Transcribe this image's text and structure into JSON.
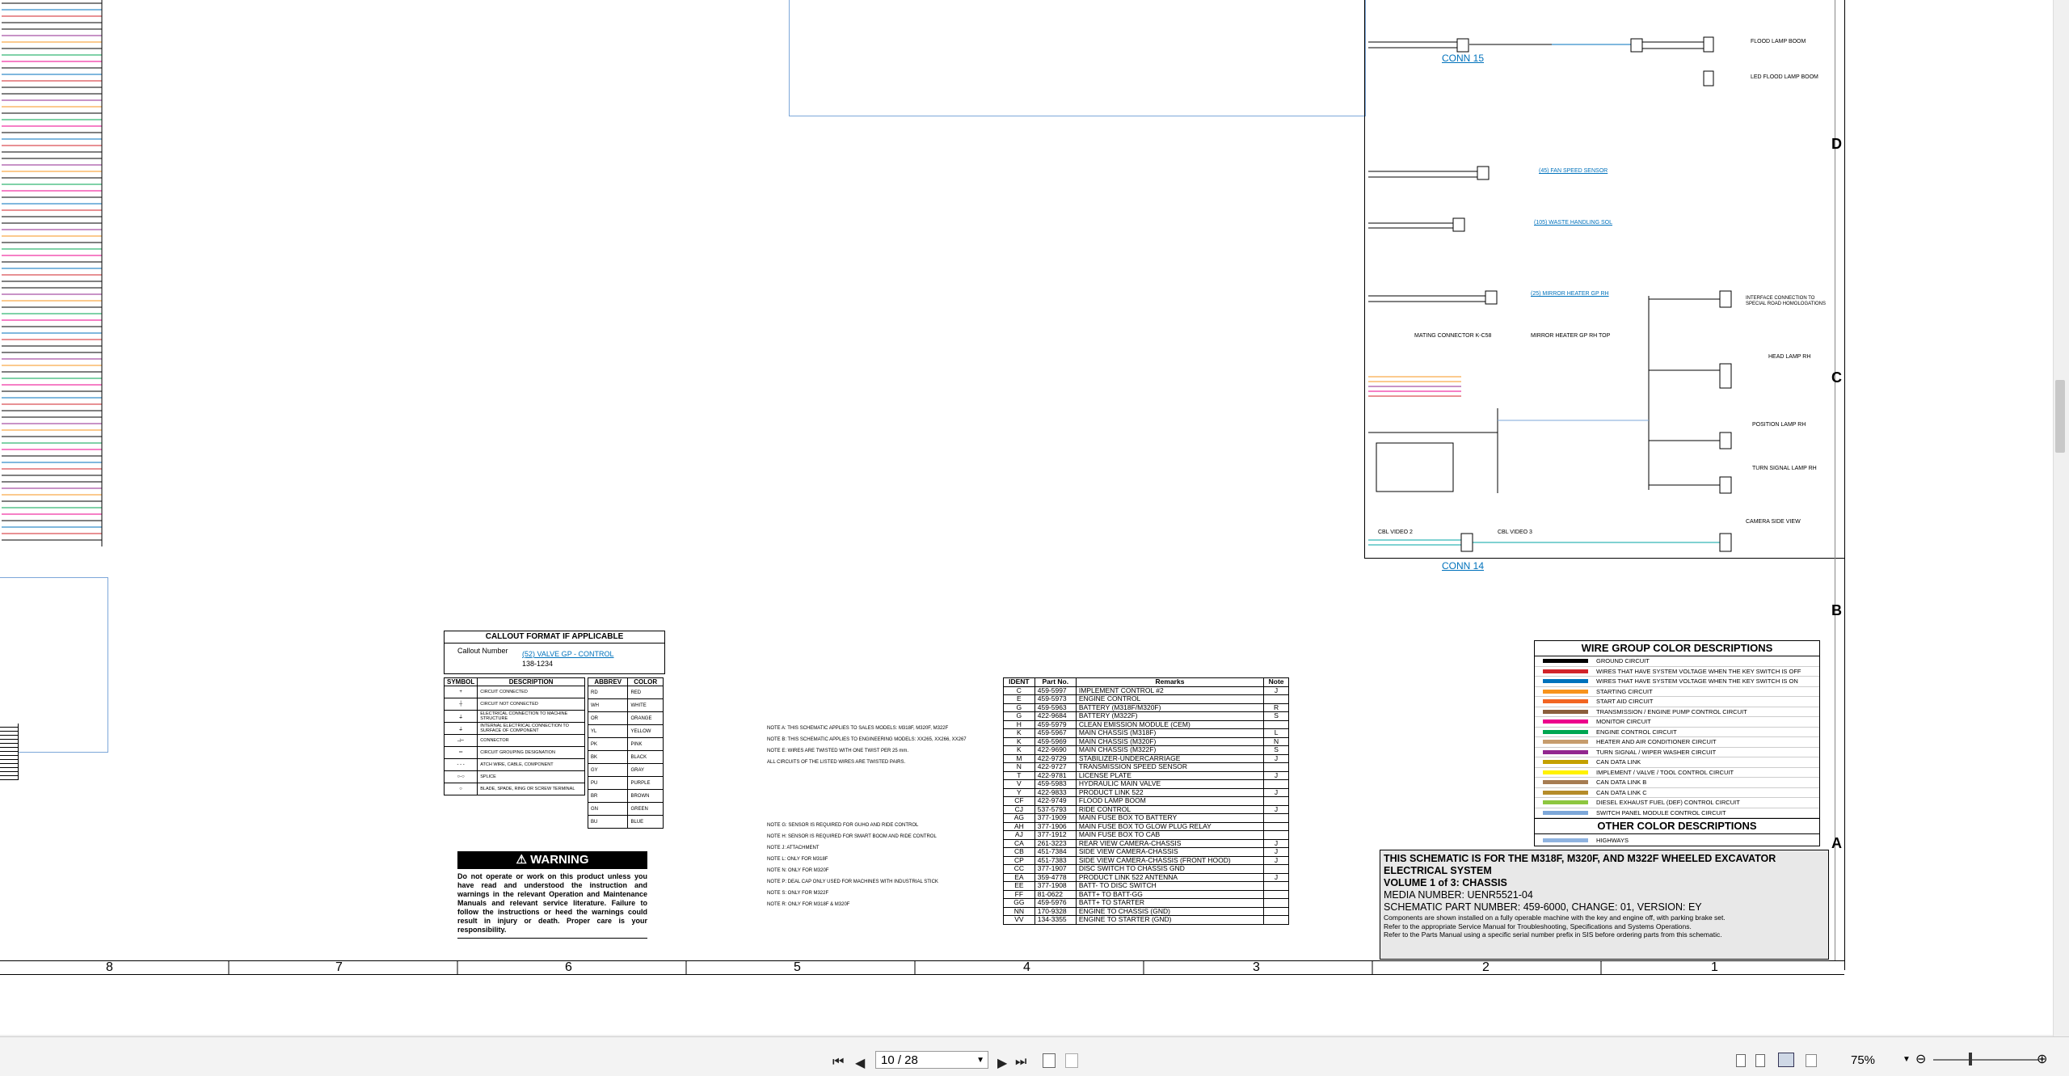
{
  "toolbar": {
    "page_value": "10 / 28",
    "zoom": "75%",
    "first_page_icon": "first-page-icon",
    "prev_page_icon": "prev-page-icon",
    "next_page_icon": "next-page-icon",
    "last_page_icon": "last-page-icon"
  },
  "schematic": {
    "row_labels": [
      "D",
      "C",
      "B",
      "A"
    ],
    "col_labels": [
      "8",
      "7",
      "6",
      "5",
      "4",
      "3",
      "2",
      "1"
    ],
    "connectors": {
      "conn15": "CONN 15",
      "conn14": "CONN 14",
      "flood_lamp": "FLOOD LAMP BOOM",
      "led_flood": "LED FLOOD LAMP BOOM",
      "fan_speed": "(45) FAN SPEED SENSOR",
      "waste_sol": "(105) WASTE HANDLING SOL",
      "mirror_heater_rh": "(25) MIRROR HEATER GP RH",
      "mirror_heater_top": "MIRROR HEATER GP RH TOP",
      "head_lamp": "HEAD LAMP RH",
      "position_lamp": "POSITION LAMP RH",
      "turn_signal": "TURN SIGNAL LAMP RH",
      "camera": "CAMERA SIDE VIEW",
      "cbl_video2": "CBL VIDEO 2",
      "cbl_video3": "CBL VIDEO 3",
      "interface": "INTERFACE CONNECTION TO SPECIAL ROAD HOMOLOGATIONS",
      "mating": "MATING CONNECTOR K-C58"
    }
  },
  "callout": {
    "title": "CALLOUT FORMAT IF APPLICABLE",
    "callout_number": "Callout Number",
    "valve_label": "(52) VALVE GP - CONTROL",
    "part_number": "138-1234",
    "headers": [
      "SYMBOL",
      "DESCRIPTION",
      "ABBREV",
      "COLOR"
    ],
    "descriptions": [
      "CIRCUIT CONNECTED",
      "CIRCUIT NOT CONNECTED",
      "ELECTRICAL CONNECTION TO MACHINE STRUCTURE",
      "INTERNAL ELECTRICAL CONNECTION TO SURFACE OF COMPONENT",
      "CONNECTOR",
      "CIRCUIT GROUPING DESIGNATION",
      "ATCH WIRE, CABLE, COMPONENT",
      "SPLICE",
      "BLADE, SPADE, RING OR SCREW TERMINAL"
    ],
    "abbrevs": [
      "RD",
      "WH",
      "OR",
      "YL",
      "PK",
      "BK",
      "GY",
      "PU",
      "BR",
      "GN",
      "BU"
    ],
    "colors": [
      "RED",
      "WHITE",
      "ORANGE",
      "YELLOW",
      "PINK",
      "BLACK",
      "GRAY",
      "PURPLE",
      "BROWN",
      "GREEN",
      "BLUE"
    ]
  },
  "warning": {
    "title": "WARNING",
    "text": "Do not operate or work on this product unless you have read and understood the instruction and warnings in the relevant Operation and Maintenance Manuals and relevant service literature. Failure to follow the instructions or heed the warnings could result in injury or death. Proper care is your responsibility."
  },
  "notes": [
    "NOTE A: THIS SCHEMATIC APPLIES TO SALES MODELS: M318F, M320F, M322F",
    "NOTE B: THIS SCHEMATIC APPLIES TO ENGINEERING MODELS: XX265, XX266, XX267",
    "NOTE E: WIRES ARE TWISTED WITH ONE TWIST PER 25 mm.",
    "ALL CIRCUITS OF THE LISTED WIRES ARE TWISTED PAIRS.",
    "NOTE G: SENSOR IS REQUIRED FOR GUHO AND RIDE CONTROL",
    "NOTE H: SENSOR IS REQUIRED FOR SMART BOOM AND RIDE CONTROL",
    "NOTE J: ATTACHMENT",
    "NOTE L: ONLY FOR M318F",
    "NOTE N: ONLY FOR M320F",
    "NOTE P: DEAL CAP ONLY USED FOR MACHINES WITH INDUSTRIAL STICK",
    "NOTE S: ONLY FOR M322F",
    "NOTE R: ONLY FOR M318F & M320F"
  ],
  "parts_table": {
    "headers": [
      "IDENT",
      "Part No.",
      "Remarks",
      "Note"
    ],
    "rows": [
      [
        "C",
        "459-5997",
        "IMPLEMENT CONTROL #2",
        "J"
      ],
      [
        "E",
        "459-5973",
        "ENGINE CONTROL",
        ""
      ],
      [
        "G",
        "459-5963",
        "BATTERY (M318F/M320F)",
        "R"
      ],
      [
        "G",
        "422-9684",
        "BATTERY (M322F)",
        "S"
      ],
      [
        "H",
        "459-5979",
        "CLEAN EMISSION MODULE (CEM)",
        ""
      ],
      [
        "K",
        "459-5967",
        "MAIN CHASSIS (M318F)",
        "L"
      ],
      [
        "K",
        "459-5969",
        "MAIN CHASSIS (M320F)",
        "N"
      ],
      [
        "K",
        "422-9690",
        "MAIN CHASSIS (M322F)",
        "S"
      ],
      [
        "M",
        "422-9729",
        "STABILIZER-UNDERCARRIAGE",
        "J"
      ],
      [
        "N",
        "422-9727",
        "TRANSMISSION SPEED SENSOR",
        ""
      ],
      [
        "T",
        "422-9781",
        "LICENSE PLATE",
        "J"
      ],
      [
        "V",
        "459-5983",
        "HYDRAULIC MAIN VALVE",
        ""
      ],
      [
        "Y",
        "422-9833",
        "PRODUCT LINK 522",
        "J"
      ],
      [
        "CF",
        "422-9749",
        "FLOOD LAMP BOOM",
        ""
      ],
      [
        "CJ",
        "537-5793",
        "RIDE CONTROL",
        "J"
      ],
      [
        "AG",
        "377-1909",
        "MAIN FUSE BOX TO BATTERY",
        ""
      ],
      [
        "AH",
        "377-1906",
        "MAIN FUSE BOX TO GLOW PLUG RELAY",
        ""
      ],
      [
        "AJ",
        "377-1912",
        "MAIN FUSE BOX TO CAB",
        ""
      ],
      [
        "CA",
        "261-3223",
        "REAR VIEW CAMERA-CHASSIS",
        "J"
      ],
      [
        "CB",
        "451-7384",
        "SIDE VIEW CAMERA-CHASSIS",
        "J"
      ],
      [
        "CP",
        "451-7383",
        "SIDE VIEW CAMERA-CHASSIS (FRONT HOOD)",
        "J"
      ],
      [
        "CC",
        "377-1907",
        "DISC SWITCH TO CHASSIS GND",
        ""
      ],
      [
        "EA",
        "359-4778",
        "PRODUCT LINK 522 ANTENNA",
        "J"
      ],
      [
        "EE",
        "377-1908",
        "BATT- TO DISC SWITCH",
        ""
      ],
      [
        "FF",
        "81-0622",
        "BATT+ TO BATT-GG",
        ""
      ],
      [
        "GG",
        "459-5976",
        "BATT+ TO STARTER",
        ""
      ],
      [
        "NN",
        "170-9328",
        "ENGINE TO CHASSIS (GND)",
        ""
      ],
      [
        "VV",
        "134-3355",
        "ENGINE TO STARTER (GND)",
        ""
      ]
    ]
  },
  "wire_groups": {
    "title": "WIRE GROUP COLOR DESCRIPTIONS",
    "other_title": "OTHER COLOR DESCRIPTIONS",
    "items": [
      {
        "label": "GROUND CIRCUIT",
        "color": "#000000"
      },
      {
        "label": "WIRES THAT HAVE SYSTEM VOLTAGE WHEN THE KEY SWITCH IS OFF",
        "color": "#d2232a"
      },
      {
        "label": "WIRES THAT HAVE SYSTEM VOLTAGE WHEN THE KEY SWITCH IS ON",
        "color": "#0072bc"
      },
      {
        "label": "STARTING CIRCUIT",
        "color": "#f7941d"
      },
      {
        "label": "START AID CIRCUIT",
        "color": "#f26522"
      },
      {
        "label": "TRANSMISSION / ENGINE PUMP CONTROL CIRCUIT",
        "color": "#8b5e3c"
      },
      {
        "label": "MONITOR CIRCUIT",
        "color": "#ec008c"
      },
      {
        "label": "ENGINE CONTROL CIRCUIT",
        "color": "#00a651"
      },
      {
        "label": "HEATER AND AIR CONDITIONER CIRCUIT",
        "color": "#c69c6d"
      },
      {
        "label": "TURN SIGNAL / WIPER WASHER CIRCUIT",
        "color": "#92278f"
      },
      {
        "label": "CAN DATA LINK",
        "color": "#c4a000"
      },
      {
        "label": "IMPLEMENT / VALVE / TOOL CONTROL CIRCUIT",
        "color": "#fff200"
      },
      {
        "label": "CAN DATA LINK B",
        "color": "#a67c52"
      },
      {
        "label": "CAN DATA LINK C",
        "color": "#b58c2a"
      },
      {
        "label": "DIESEL EXHAUST FUEL (DEF) CONTROL CIRCUIT",
        "color": "#8dc63f"
      },
      {
        "label": "SWITCH PANEL MODULE CONTROL CIRCUIT",
        "color": "#7da7d9"
      }
    ],
    "other_items": [
      {
        "label": "HIGHWAYS",
        "color": "#8fb3e0"
      }
    ]
  },
  "title_block": {
    "line1": "THIS SCHEMATIC IS FOR THE M318F, M320F, AND M322F WHEELED EXCAVATOR",
    "line2": "ELECTRICAL SYSTEM",
    "line3": "VOLUME 1 of 3: CHASSIS",
    "line4": "MEDIA NUMBER: UENR5521-04",
    "line5": "SCHEMATIC PART NUMBER: 459-6000, CHANGE: 01, VERSION: EY",
    "line6": "Components are shown installed on a fully operable machine with the key and engine off, with parking brake set.",
    "line7": "Refer to the appropriate Service Manual for Troubleshooting, Specifications and Systems Operations.",
    "line8": "Refer to the Parts Manual using a specific serial number prefix in SIS before ordering parts from this schematic."
  }
}
